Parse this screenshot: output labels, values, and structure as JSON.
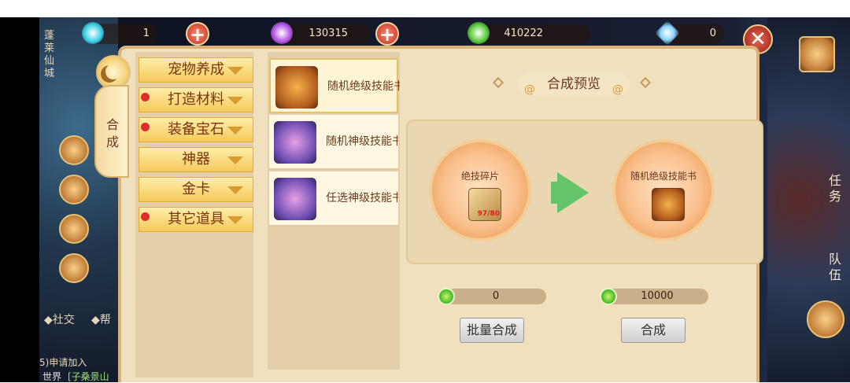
{
  "resources": [
    {
      "value": "1",
      "gem_color": "#3ad0e6",
      "icon": "cyan-gem-icon"
    },
    {
      "value": "130315",
      "gem_color": "#b456e6",
      "icon": "purple-gem-icon"
    },
    {
      "value": "410222",
      "gem_color": "#5acc3a",
      "icon": "green-gem-icon"
    },
    {
      "value": "0",
      "gem_color": "#8ad6ff",
      "icon": "diamond-icon"
    }
  ],
  "plus_glyph": "+",
  "close_glyph": "✕",
  "vertical_tab": {
    "label": "合成"
  },
  "categories": [
    {
      "label": "宠物养成",
      "red_dot": false
    },
    {
      "label": "打造材料",
      "red_dot": true
    },
    {
      "label": "装备宝石",
      "red_dot": true
    },
    {
      "label": "神器",
      "red_dot": false
    },
    {
      "label": "金卡",
      "red_dot": false
    },
    {
      "label": "其它道具",
      "red_dot": true
    }
  ],
  "items": [
    {
      "name": "随机绝级技能书",
      "icon": "golden-chest-icon",
      "selected": true
    },
    {
      "name": "随机神级技能书",
      "icon": "purple-chest-icon",
      "selected": false
    },
    {
      "name": "任选神级技能书",
      "icon": "purple-chest-icon",
      "selected": false
    }
  ],
  "preview": {
    "title": "合成预览",
    "source": {
      "label": "绝技碎片",
      "count": "97/80",
      "icon": "scroll-fragment-icon"
    },
    "target": {
      "label": "随机绝级技能书",
      "icon": "golden-chest-icon"
    }
  },
  "batch": {
    "cost": "0",
    "button": "批量合成"
  },
  "single": {
    "cost": "10000",
    "button": "合成"
  },
  "left_scene": {
    "signboard": "蓬莱仙城"
  },
  "right_side": {
    "task": "任务",
    "team": "队伍"
  },
  "chat": {
    "social": "社交",
    "help": "帮",
    "join": "5)申请加入",
    "channel": "世界",
    "message": "[子桑景山"
  },
  "colors": {
    "panel": "#f1e0bd",
    "panel_border": "#d9b27a",
    "category_tab": "#f5c95c",
    "red_dot": "#e12c2c",
    "arrow": "#63c46a"
  }
}
